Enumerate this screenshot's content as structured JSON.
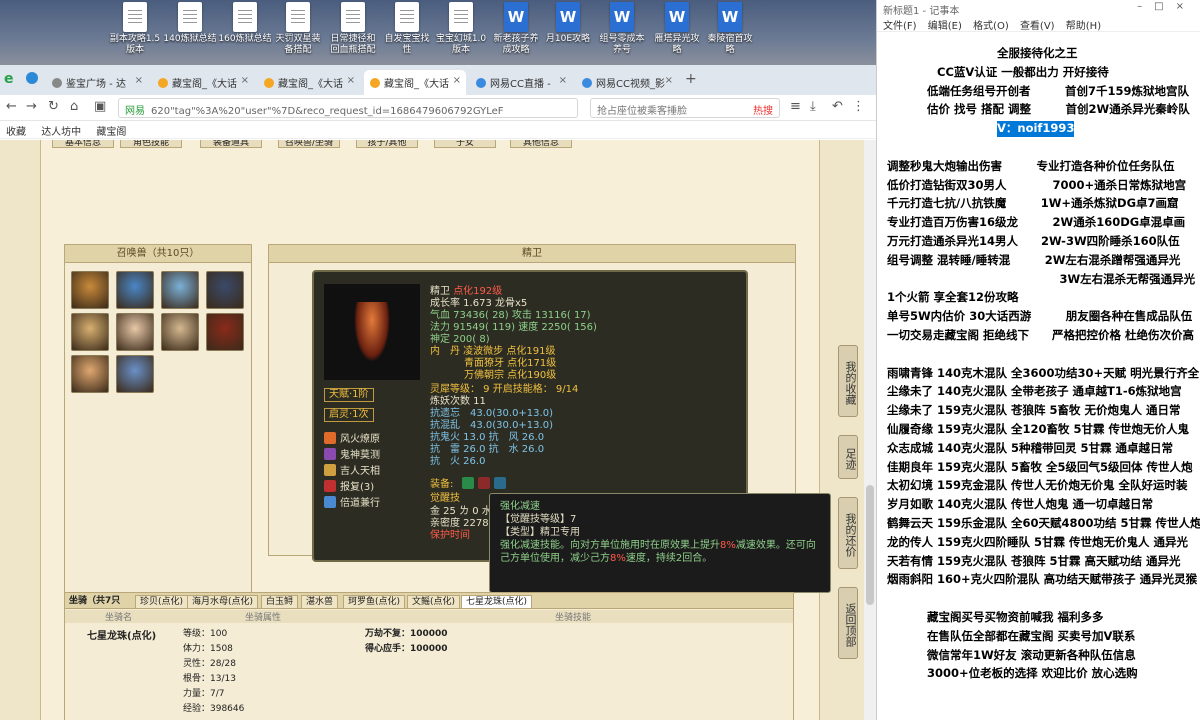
{
  "desktop": {
    "icons": [
      {
        "label": "副本攻略1.5\n版本",
        "type": "text"
      },
      {
        "label": "140炼狱总结",
        "type": "text"
      },
      {
        "label": "160炼狱总结",
        "type": "text"
      },
      {
        "label": "天罚双星装\n备搭配",
        "type": "text"
      },
      {
        "label": "日常捷径和\n回血瓶搭配",
        "type": "text"
      },
      {
        "label": "自发宝宝找\n性",
        "type": "text"
      },
      {
        "label": "宝宝幻城1.0\n版本",
        "type": "text"
      },
      {
        "label": "新老孩子养\n成攻略",
        "type": "word"
      },
      {
        "label": "月10E攻略",
        "type": "word"
      },
      {
        "label": "组号零成本\n养号",
        "type": "word"
      },
      {
        "label": "雁塔异光攻\n略",
        "type": "word"
      },
      {
        "label": "秦陵宿首攻\n略",
        "type": "word"
      }
    ]
  },
  "browser": {
    "tabs": [
      {
        "label": "鉴宝广场 - 达",
        "active": false
      },
      {
        "label": "藏宝阁_《大话",
        "active": false
      },
      {
        "label": "藏宝阁_《大话",
        "active": false
      },
      {
        "label": "藏宝阁_《大话",
        "active": true
      },
      {
        "label": "网易CC直播 -",
        "active": false
      },
      {
        "label": "网易CC视频_影",
        "active": false
      }
    ],
    "url_prefix": "网易",
    "url": "620\"tag\"%3A%20\"user\"%7D&reco_request_id=1686479606792GYLeF",
    "search_placeholder": "抢占座位被乘客捶脸",
    "search_hot": "热搜",
    "favorites": [
      "收藏",
      "达人坊中",
      "藏宝阁"
    ]
  },
  "game": {
    "top_buttons": [
      "基本信息",
      "角色技能",
      "装备道具",
      "召唤兽/坐骑",
      "孩子/其他",
      "子女",
      "其他信息"
    ],
    "pets_panel_title": "召唤兽（共10只）",
    "pet_colors": [
      "#c98a3a",
      "#4a86c6",
      "#7bb0d8",
      "#3a4a6a",
      "#d8b070",
      "#e8c8a8",
      "#d4b890",
      "#8a2a1a",
      "#e0a870",
      "#6a90c8"
    ],
    "detail_panel_title": "精卫",
    "stats": {
      "name_line": "精卫",
      "name_tag": "点化192级",
      "growth": "成长率 1.673 龙骨x5",
      "hp": "气血 73436( 28) 攻击 13116( 17)",
      "mp": "法力 91549( 119) 速度 2250( 156)",
      "spirit": "神定 200( 8)",
      "neidan_1": "内　丹 凌波微步 点化191级",
      "neidan_2": "青面獠牙 点化171级",
      "neidan_3": "万佛朝宗 点化190级",
      "soul_level": "灵犀等级： 9 开启技能格： 9/14",
      "refine": "炼妖次数 11",
      "resist_forget": "抗遗忘　43.0(30.0+13.0)",
      "resist_chaos": "抗混乱　43.0(30.0+13.0)",
      "resist_ghost": "抗鬼火 13.0 抗　风 26.0",
      "resist_thunder": "抗　雷 26.0 抗　水 26.0",
      "resist_fire": "抗　火 26.0",
      "equip_label": "装备:",
      "awaken_label": "觉醒技",
      "gold_line": "金 25 ㄌ 0 水",
      "intimacy": "亲密度 22781",
      "protect": "保护时间"
    },
    "tags": [
      "天赋·1阶",
      "启灵·1次"
    ],
    "skills": [
      {
        "name": "风火燎原",
        "color": "#e06a2a"
      },
      {
        "name": "鬼神莫测",
        "color": "#8a4ab0"
      },
      {
        "name": "吉人天相",
        "color": "#d0a040"
      },
      {
        "name": "报复(3)",
        "color": "#c03030"
      },
      {
        "name": "倍道兼行",
        "color": "#4a8ad0"
      }
    ],
    "tooltip": {
      "title": "强化减速",
      "level": "【觉醒技等级】7",
      "type": "【类型】精卫专用",
      "desc": "强化减速技能。向对方单位施用时在原效果上提升8%减速效果。还可向己方单位使用，减少己方8%速度，持续2回合。"
    },
    "side_buttons": [
      "我的收藏",
      "足迹",
      "我的还价",
      "返回顶部"
    ],
    "mount_tabs": [
      "坐骑（共7只",
      "珍贝(点化)",
      "海月水母(点化)",
      "白玉鲟",
      "湛水兽",
      "珂罗鱼(点化)",
      "文鳐(点化)",
      "七星龙珠(点化)"
    ],
    "mount_header": [
      "坐骑名",
      "坐骑属性",
      "坐骑技能"
    ],
    "mount": {
      "name": "七星龙珠(点化)",
      "attrs": [
        "等级：100",
        "体力：1508",
        "灵性：28/28",
        "根骨：13/13",
        "力量：7/7",
        "经验：398646"
      ],
      "skills": [
        "万劫不复：100000",
        "得心应手：100000"
      ]
    }
  },
  "notepad": {
    "title": "新标题1 - 记事本",
    "menu": [
      "文件(F)",
      "编辑(E)",
      "格式(O)",
      "查看(V)",
      "帮助(H)"
    ],
    "lines": [
      "全服接待化之王",
      "CC蓝V认证 一般都出力 开好接待",
      "低端任务组号开创者　　　首创7千159炼狱地宫队",
      "估价 找号 搭配 调整　　　首创2W通杀异光秦岭队",
      "V：noif1993",
      "",
      "调整秒鬼大炮输出伤害　　　专业打造各种价位任务队伍",
      "低价打造钻街双30男人　　　　7000+通杀日常炼狱地宫",
      "千元打造七抗/八抗铁魔　　　1W+通杀炼狱DG卓7画窟",
      "专业打造百万伤害16级龙　　　2W通杀160DG卓混卓画",
      "万元打造通杀异光14男人　　2W-3W四阶睡杀160队伍",
      "组号调整 混转睡/睡转混　　　2W左右混杀蹭帮强通异光",
      "　　　　　　　　　　　　　　　3W左右混杀无帮强通异光",
      "1个火箭 享全套12份攻略",
      "单号5W内估价 30大话西游　　　朋友圈各种在售成品队伍",
      "一切交易走藏宝阁 拒绝线下　　严格把控价格 杜绝伤次价高",
      "",
      "雨啸青锋 140克木混队 全3600功结30+天赋 明光景行齐全",
      "尘缘未了 140克火混队 全带老孩子 通卓越T1-6炼狱地宫",
      "尘缘未了 159克火混队 苍狼阵 5畜牧 无价炮鬼人 通日常",
      "仙履奇缘 159克火混队 全120畜牧 5甘霖 传世炮无价人鬼",
      "众志成城 140克火混队 5种稽带回灵 5甘霖 通卓越日常",
      "佳期良年 159克火混队 5畜牧 全5级回气5级回体 传世人炮",
      "太初幻境 159克金混队 传世人无价炮无价鬼 全队好运时装",
      "岁月如歌 140克火混队 传世人炮鬼 通一切卓越日常",
      "鹤舞云天 159乐金混队 全60天赋4800功结 5甘霖 传世人炮",
      "龙的传人 159克火四阶睡队 5甘霖 传世炮无价鬼人 通异光",
      "天若有情 159克火混队 苍狼阵 5甘霖 高天赋功结 通异光",
      "烟雨斜阳 160+克火四阶混队 高功结天赋带孩子 通异光灵猴",
      "",
      "藏宝阁买号买物资前喊我 福利多多",
      "在售队伍全部都在藏宝阁 买卖号加V联系",
      "微信常年1W好友 滚动更新各种队伍信息",
      "3000+位老板的选择 欢迎比价 放心选购"
    ]
  },
  "colors": {
    "accent": "#0078d7",
    "hot": "#ee3333",
    "green_text": "#8ed08a",
    "red_text": "#ff5a4a"
  }
}
